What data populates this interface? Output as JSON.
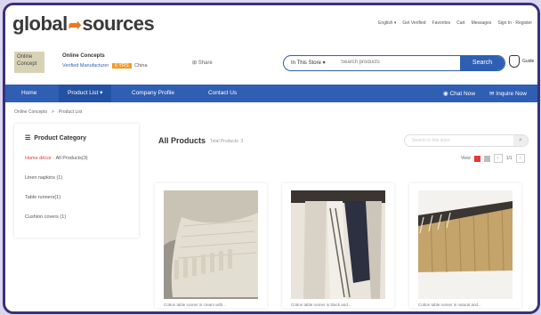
{
  "header": {
    "logo_left": "global",
    "logo_right": "sources",
    "links": [
      "English ▾",
      "Get Verified",
      "Favorites",
      "Cart",
      "Messages",
      "Sign In · Register"
    ]
  },
  "supplier": {
    "logo_text": "Online Concept",
    "name": "Online Concepts",
    "verified": "Verified Manufacturer",
    "years": "6 YRS",
    "years_suffix": "China",
    "share": "Share"
  },
  "search": {
    "scope": "In This Store ▾",
    "placeholder": "Search products",
    "button": "Search",
    "shield_label": "Guide"
  },
  "nav": {
    "items": [
      "Home",
      "Product List ▾",
      "Company Profile",
      "Contact Us"
    ],
    "right_items": [
      "Chat Now",
      "Inquire Now"
    ]
  },
  "breadcrumb": [
    "Online Concepts",
    "Product List"
  ],
  "sidebar": {
    "title": "Product Category",
    "rows": [
      {
        "label": "Home décor",
        "suffix": "All Products(3)"
      },
      {
        "label": "Linen napkins (1)"
      },
      {
        "label": "Table runners(1)"
      },
      {
        "label": "Cushion covers (1)"
      }
    ]
  },
  "main": {
    "title": "All Products",
    "count": "Total Products: 3",
    "search_placeholder": "Search in this store",
    "view_label": "View",
    "page": "1/1"
  },
  "products": [
    {
      "caption": "Cotton table runner in cream with..."
    },
    {
      "caption": "Cotton table runner in black and..."
    },
    {
      "caption": "Cotton table runner in natural and..."
    }
  ],
  "colors": {
    "brand_blue": "#2f5fb3",
    "accent_orange": "#e87722",
    "frame_purple": "#3b2f7a"
  }
}
